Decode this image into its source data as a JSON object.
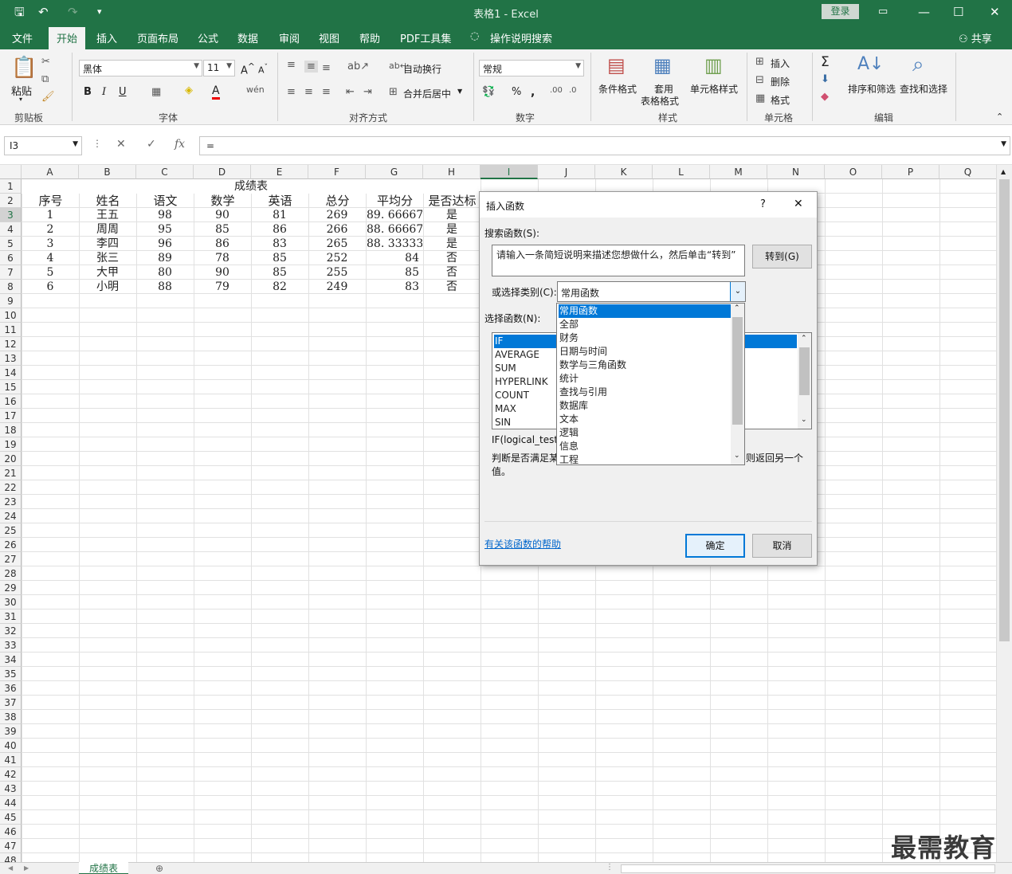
{
  "app": {
    "title": "表格1  -  Excel",
    "login": "登录",
    "share": "共享",
    "qat_more": "▾"
  },
  "ribbon_tabs": [
    "文件",
    "开始",
    "插入",
    "页面布局",
    "公式",
    "数据",
    "审阅",
    "视图",
    "帮助",
    "PDF工具集",
    "操作说明搜索"
  ],
  "ribbon": {
    "paste": "粘贴",
    "font_name": "黑体",
    "font_size": "11",
    "bold": "B",
    "italic": "I",
    "underline": "U",
    "wrap": "自动换行",
    "merge": "合并后居中",
    "number_format": "常规",
    "conditional": "条件格式",
    "table_fmt_1": "套用",
    "table_fmt_2": "表格格式",
    "cell_style": "单元格样式",
    "insert": "插入",
    "delete": "删除",
    "format": "格式",
    "sort": "排序和筛选",
    "find": "查找和选择",
    "groups": [
      "剪贴板",
      "字体",
      "对齐方式",
      "数字",
      "样式",
      "单元格",
      "编辑"
    ]
  },
  "formula_bar": {
    "name_box": "I3",
    "content": "="
  },
  "columns": [
    "A",
    "B",
    "C",
    "D",
    "E",
    "F",
    "G",
    "H",
    "I",
    "J",
    "K",
    "L",
    "M",
    "N",
    "O",
    "P",
    "Q"
  ],
  "rows": [
    "1",
    "2",
    "3",
    "4",
    "5",
    "6",
    "7",
    "8",
    "9",
    "10",
    "11",
    "12",
    "13",
    "14",
    "15",
    "16",
    "17",
    "18",
    "19",
    "20",
    "21",
    "22",
    "23",
    "24",
    "25",
    "26",
    "27",
    "28",
    "29",
    "30",
    "31",
    "32",
    "33",
    "34",
    "35",
    "36",
    "37",
    "38",
    "39",
    "40",
    "41",
    "42",
    "43",
    "44",
    "45",
    "46",
    "47",
    "48"
  ],
  "sheet": {
    "title": "成绩表",
    "headers": [
      "序号",
      "姓名",
      "语文",
      "数学",
      "英语",
      "总分",
      "平均分",
      "是否达标"
    ],
    "data": [
      [
        "1",
        "王五",
        "98",
        "90",
        "81",
        "269",
        "89. 66667",
        "是"
      ],
      [
        "2",
        "周周",
        "95",
        "85",
        "86",
        "266",
        "88. 66667",
        "是"
      ],
      [
        "3",
        "李四",
        "96",
        "86",
        "83",
        "265",
        "88. 33333",
        "是"
      ],
      [
        "4",
        "张三",
        "89",
        "78",
        "85",
        "252",
        "84",
        "否"
      ],
      [
        "5",
        "大甲",
        "80",
        "90",
        "85",
        "255",
        "85",
        "否"
      ],
      [
        "6",
        "小明",
        "88",
        "79",
        "82",
        "249",
        "83",
        "否"
      ]
    ],
    "tab_name": "成绩表"
  },
  "dialog": {
    "title": "插入函数",
    "help": "?",
    "close": "✕",
    "search_label": "搜索函数(S):",
    "search_placeholder": "请输入一条简短说明来描述您想做什么，然后单击“转到”",
    "goto": "转到(G)",
    "category_label": "或选择类别(C):",
    "category_value": "常用函数",
    "select_label": "选择函数(N):",
    "functions": [
      "IF",
      "AVERAGE",
      "SUM",
      "HYPERLINK",
      "COUNT",
      "MAX",
      "SIN"
    ],
    "syntax": "IF(logical_test,",
    "desc_1": "判断是否满足某",
    "desc_2": "值。",
    "desc_tail": "则返回另一个",
    "help_link": "有关该函数的帮助",
    "ok": "确定",
    "cancel": "取消"
  },
  "category_dropdown": [
    "常用函数",
    "全部",
    "财务",
    "日期与时间",
    "数学与三角函数",
    "统计",
    "查找与引用",
    "数据库",
    "文本",
    "逻辑",
    "信息",
    "工程"
  ],
  "watermark": "最需教育"
}
